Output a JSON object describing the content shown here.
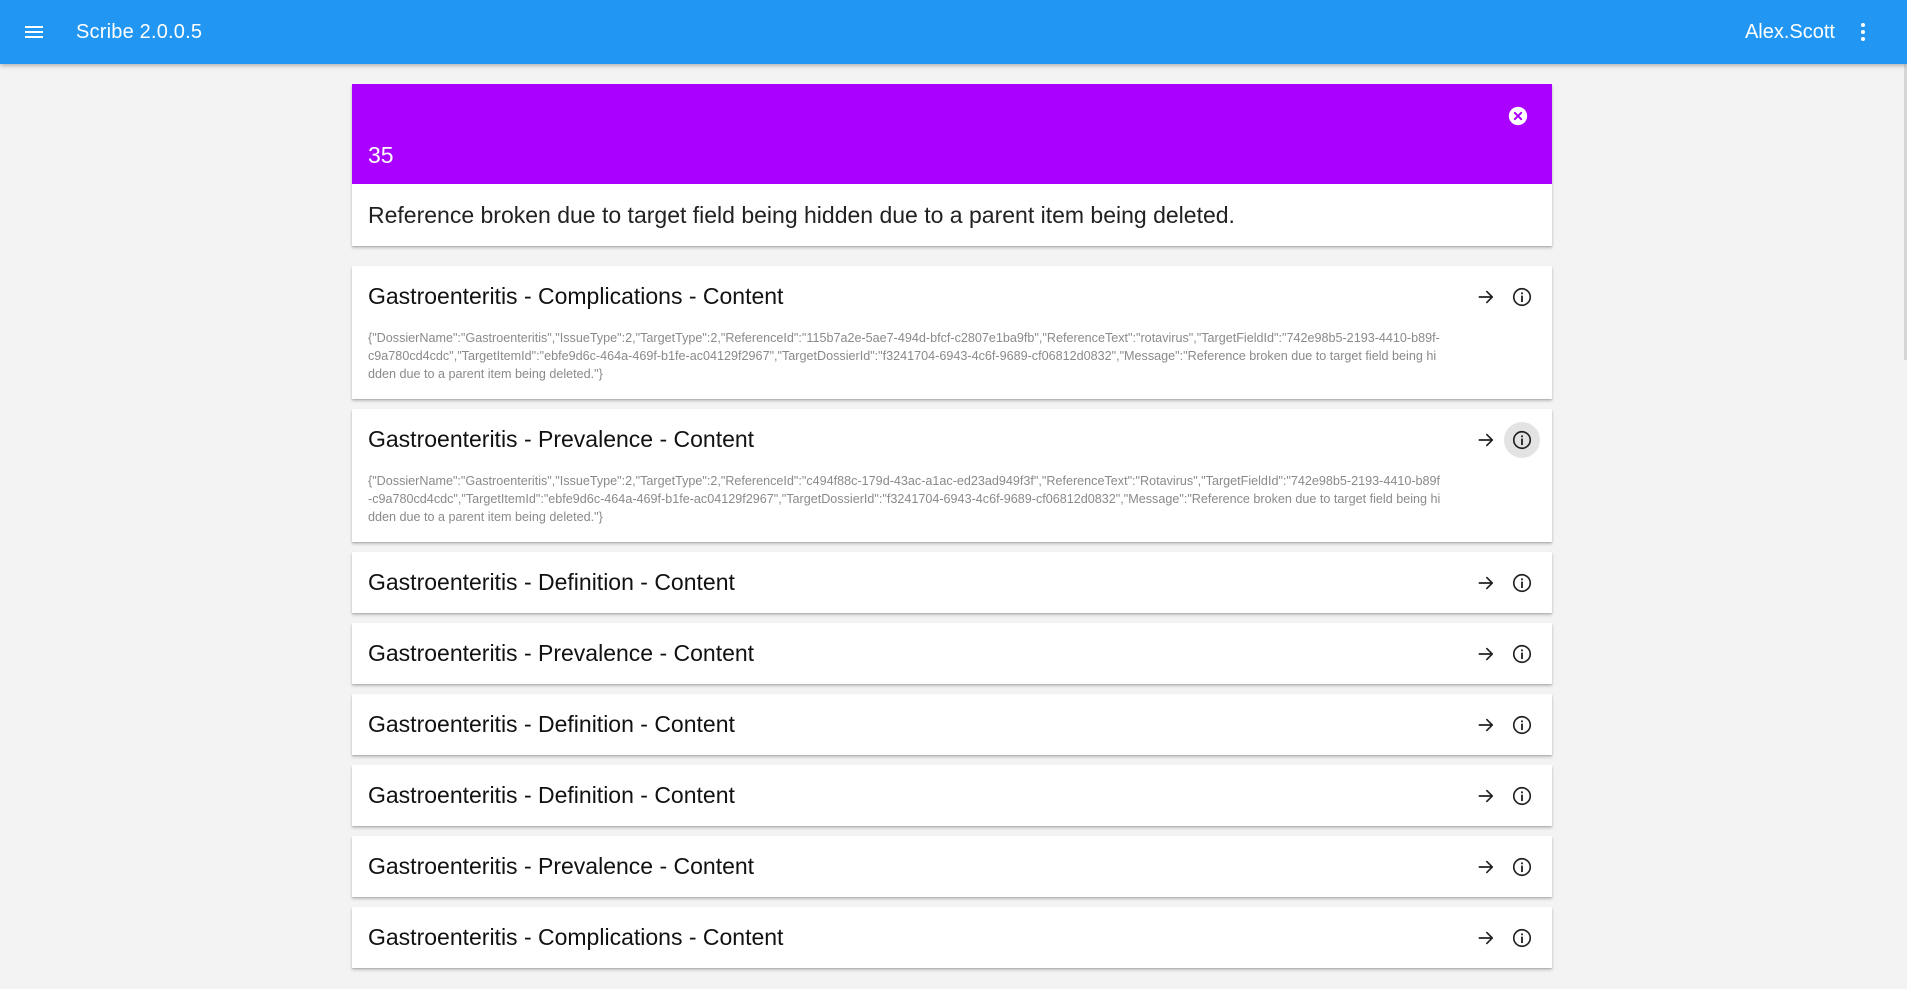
{
  "app": {
    "title": "Scribe 2.0.0.5",
    "user": "Alex.Scott",
    "accent_color": "#2196f3",
    "icons": {
      "menu": "menu-icon",
      "more": "more-vert-icon"
    }
  },
  "issue": {
    "count": "35",
    "band_color": "#aa00ff",
    "message": "Reference broken due to target field being hidden due to a parent item being deleted.",
    "close_icon": "close-circle-icon"
  },
  "references": [
    {
      "title": "Gastroenteritis - Complications - Content",
      "detail": "{\"DossierName\":\"Gastroenteritis\",\"IssueType\":2,\"TargetType\":2,\"ReferenceId\":\"115b7a2e-5ae7-494d-bfcf-c2807e1ba9fb\",\"ReferenceText\":\"rotavirus\",\"TargetFieldId\":\"742e98b5-2193-4410-b89f-c9a780cd4cdc\",\"TargetItemId\":\"ebfe9d6c-464a-469f-b1fe-ac04129f2967\",\"TargetDossierId\":\"f3241704-6943-4c6f-9689-cf06812d0832\",\"Message\":\"Reference broken due to target field being hidden due to a parent item being deleted.\"}"
    },
    {
      "title": "Gastroenteritis - Prevalence - Content",
      "detail": "{\"DossierName\":\"Gastroenteritis\",\"IssueType\":2,\"TargetType\":2,\"ReferenceId\":\"c494f88c-179d-43ac-a1ac-ed23ad949f3f\",\"ReferenceText\":\"Rotavirus\",\"TargetFieldId\":\"742e98b5-2193-4410-b89f-c9a780cd4cdc\",\"TargetItemId\":\"ebfe9d6c-464a-469f-b1fe-ac04129f2967\",\"TargetDossierId\":\"f3241704-6943-4c6f-9689-cf06812d0832\",\"Message\":\"Reference broken due to target field being hidden due to a parent item being deleted.\"}"
    },
    {
      "title": "Gastroenteritis - Definition - Content"
    },
    {
      "title": "Gastroenteritis - Prevalence - Content"
    },
    {
      "title": "Gastroenteritis - Definition - Content"
    },
    {
      "title": "Gastroenteritis - Definition - Content"
    },
    {
      "title": "Gastroenteritis - Prevalence - Content"
    },
    {
      "title": "Gastroenteritis - Complications - Content"
    }
  ],
  "row_icons": {
    "navigate": "arrow-forward-icon",
    "info": "info-icon"
  }
}
